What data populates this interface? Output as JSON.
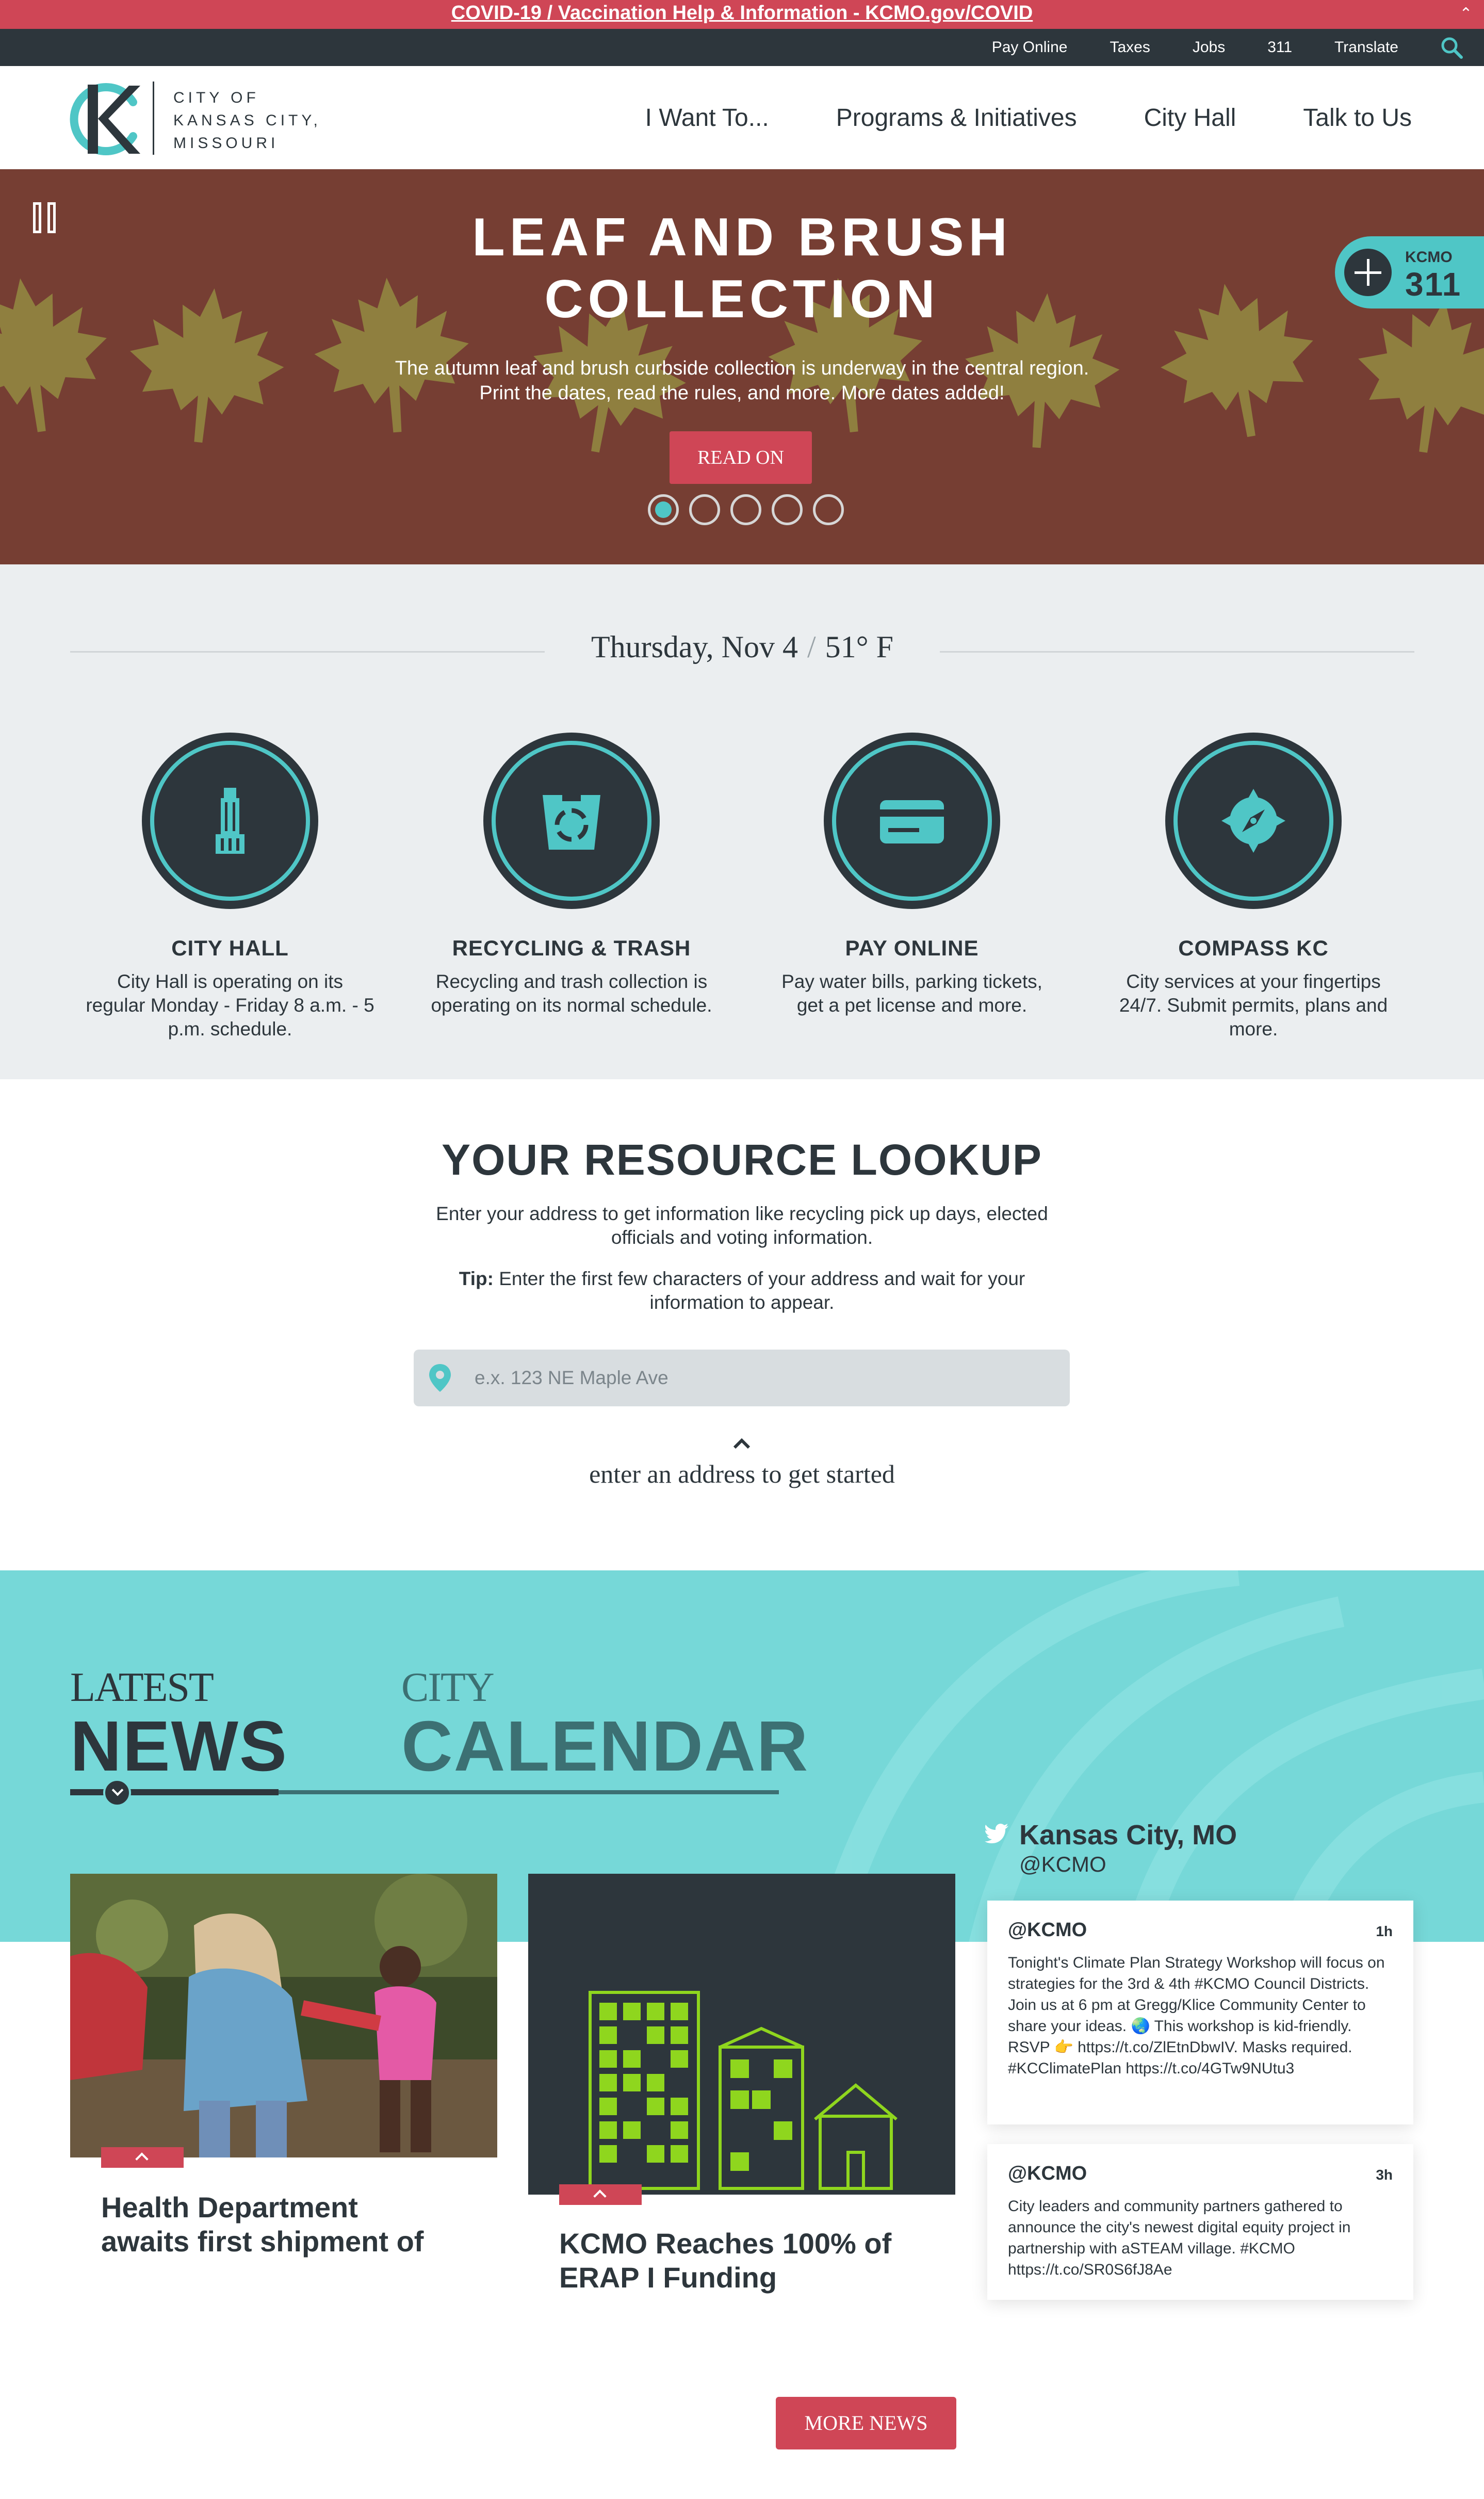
{
  "alert": {
    "text": "COVID-19 / Vaccination Help & Information - KCMO.gov/COVID"
  },
  "utility_nav": [
    "Pay Online",
    "Taxes",
    "Jobs",
    "311",
    "Translate"
  ],
  "logo": {
    "line1": "CITY OF",
    "line2": "KANSAS CITY,",
    "line3": "MISSOURI"
  },
  "main_nav": [
    "I Want To...",
    "Programs & Initiatives",
    "City Hall",
    "Talk to Us"
  ],
  "hero": {
    "title_line1": "LEAF AND BRUSH",
    "title_line2": "COLLECTION",
    "desc_line1": "The autumn leaf and brush curbside collection is underway in the central region.",
    "desc_line2": "Print the dates, read the rules, and more. More dates added!",
    "button": "READ ON",
    "slide_count": 5,
    "active_slide": 1
  },
  "kc311": {
    "top": "KCMO",
    "number": "311"
  },
  "info_bar": {
    "date": "Thursday, Nov 4",
    "temperature": "51° F"
  },
  "quick_links": [
    {
      "title": "CITY HALL",
      "desc": "City Hall is operating on its regular Monday - Friday 8 a.m. - 5 p.m. schedule.",
      "icon": "city-hall-building-icon"
    },
    {
      "title": "RECYCLING & TRASH",
      "desc": "Recycling and trash collection is operating on its normal schedule.",
      "icon": "recycling-bin-icon"
    },
    {
      "title": "PAY ONLINE",
      "desc": "Pay water bills, parking tickets, get a pet license and more.",
      "icon": "credit-card-icon"
    },
    {
      "title": "COMPASS KC",
      "desc": "City services at your fingertips 24/7. Submit permits, plans and more.",
      "icon": "compass-icon"
    }
  ],
  "lookup": {
    "title": "YOUR RESOURCE LOOKUP",
    "desc": "Enter your address to get information like recycling pick up days, elected officials and voting information.",
    "tip_label": "Tip:",
    "tip": "Enter the first few characters of your address and wait for your information to appear.",
    "placeholder": "e.x. 123 NE Maple Ave",
    "hint": "enter an address to get started"
  },
  "news_tabs": [
    {
      "top": "LATEST",
      "main": "NEWS",
      "active": true
    },
    {
      "top": "CITY",
      "main": "CALENDAR",
      "active": false
    }
  ],
  "news": [
    {
      "headline_line1": "Health Department",
      "headline_line2": "awaits first shipment of"
    },
    {
      "headline_line1": "KCMO Reaches 100% of",
      "headline_line2": "ERAP I Funding"
    }
  ],
  "twitter": {
    "name": "Kansas City, MO",
    "handle": "@KCMO",
    "tweets": [
      {
        "user": "@KCMO",
        "time": "1h",
        "text": "Tonight's Climate Plan Strategy Workshop will focus on strategies for the 3rd & 4th #KCMO Council Districts. Join us at 6 pm at Gregg/Klice Community Center to share your ideas. 🌏 This workshop is kid-friendly. RSVP 👉 https://t.co/ZlEtnDbwIV. Masks required. #KCClimatePlan https://t.co/4GTw9NUtu3"
      },
      {
        "user": "@KCMO",
        "time": "3h",
        "text": "City leaders and community partners gathered to announce the city's newest digital equity project in partnership with aSTEAM village. #KCMO https://t.co/SR0S6fJ8Ae"
      }
    ]
  },
  "more_news": "MORE NEWS",
  "colors": {
    "brand_red": "#cf4656",
    "teal": "#4fc6c6",
    "dark": "#2d363c",
    "hero_bg": "#763e33"
  }
}
